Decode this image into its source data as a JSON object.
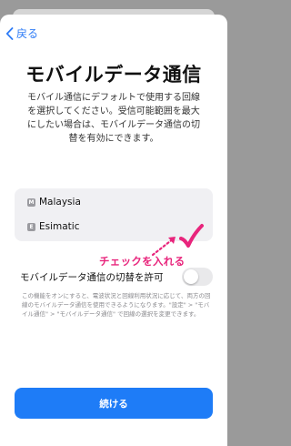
{
  "nav": {
    "back_label": "戻る"
  },
  "title": "モバイルデータ通信",
  "description": "モバイル通信にデフォルトで使用する回線を選択してください。受信可能範囲を最大にしたい場合は、モバイルデータ通信の切替を有効にできます。",
  "lines": [
    {
      "badge": "M",
      "name": "Malaysia"
    },
    {
      "badge": "E",
      "name": "Esimatic"
    }
  ],
  "annotation": {
    "text": "チェックを入れる",
    "color": "#e8257c"
  },
  "switch_setting": {
    "label": "モバイルデータ通信の切替を許可",
    "enabled": false
  },
  "footnote": "この機能をオンにすると、電波状況と回線利用状況に応じて、両方の回線のモバイルデータ通信を使用できるようになります。\"設定\" > \"モバイル通信\" > \"モバイルデータ通信\" で回線の選択を変更できます。",
  "continue_label": "続ける",
  "colors": {
    "accent": "#1e7cf7",
    "annotation": "#e8257c"
  }
}
